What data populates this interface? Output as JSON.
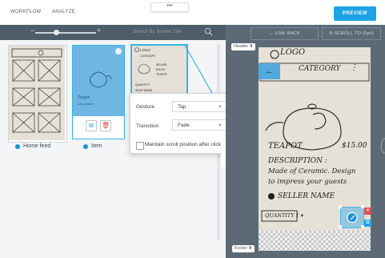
{
  "topbar": {
    "nav": [
      {
        "label": "WORKFLOW",
        "underline": "W",
        "rest": "ORKFLOW"
      },
      {
        "label": "ANALYZE",
        "underline": "N",
        "pre": "A",
        "rest": "ALYZE"
      }
    ],
    "handle_glyph": "•••",
    "preview_label": "PREVIEW",
    "accent": "#1ea4e6"
  },
  "library": {
    "zoom_minus": "−",
    "zoom_plus": "+",
    "zoom_level": 0.3,
    "search_placeholder": "Search By Screen Title",
    "screens": [
      {
        "title": "Home feed",
        "selected": false
      },
      {
        "title": "Item",
        "selected": true
      },
      {
        "title": "",
        "selected": false,
        "highlighted": true
      }
    ],
    "copy_icon_glyph": "⧉",
    "delete_icon_glyph": "🗑"
  },
  "interaction_popup": {
    "gesture_label": "Gesture",
    "gesture_value": "Tap",
    "transition_label": "Transition",
    "transition_value": "Fade",
    "maintain_scroll_label": "Maintain scroll position after click",
    "maintain_scroll_checked": false,
    "close_glyph": "×"
  },
  "canvas": {
    "link_back_label": "← LINK BACK",
    "scroll_to_label": "⇅ SCROLL TO (0px)",
    "header_pill": "Header ⬍",
    "footer_pill": "Footer ⬍",
    "sketch": {
      "logo": "LOGO",
      "category": "CATEGORY",
      "product": "TEAPOT",
      "price": "$15.00",
      "description_title": "DESCRIPTION :",
      "description_lines": [
        "Made of Ceramic. Design",
        "to impress your guests"
      ],
      "seller": "SELLER NAME",
      "quantity": "QUANTITY 1 ▾"
    }
  }
}
